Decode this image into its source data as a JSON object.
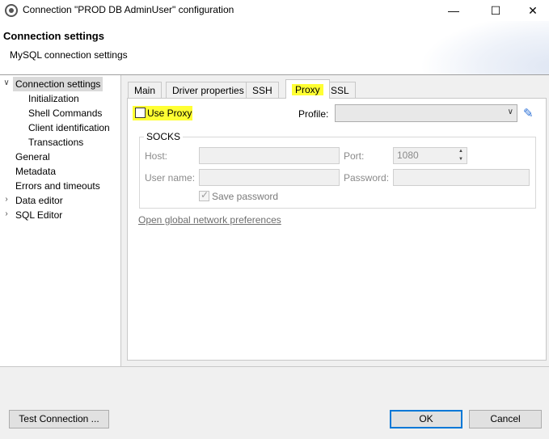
{
  "window": {
    "title": "Connection \"PROD DB AdminUser\" configuration",
    "minimize": "—",
    "maximize": "☐",
    "close": "✕"
  },
  "header": {
    "title": "Connection settings",
    "subtitle": "MySQL connection settings"
  },
  "tree": {
    "items": [
      {
        "label": "Connection settings",
        "expanded": true,
        "selected": true
      },
      {
        "label": "Initialization"
      },
      {
        "label": "Shell Commands"
      },
      {
        "label": "Client identification"
      },
      {
        "label": "Transactions"
      },
      {
        "label": "General"
      },
      {
        "label": "Metadata"
      },
      {
        "label": "Errors and timeouts"
      },
      {
        "label": "Data editor",
        "expandable": true
      },
      {
        "label": "SQL Editor",
        "expandable": true
      }
    ]
  },
  "tabs": [
    {
      "label": "Main"
    },
    {
      "label": "Driver properties"
    },
    {
      "label": "SSH"
    },
    {
      "label": "Proxy",
      "active": true
    },
    {
      "label": "SSL"
    }
  ],
  "proxy": {
    "use_proxy_label": "Use Proxy",
    "use_proxy_checked": false,
    "profile_label": "Profile:",
    "profile_value": "",
    "socks_legend": "SOCKS",
    "host_label": "Host:",
    "host_value": "",
    "port_label": "Port:",
    "port_value": "1080",
    "username_label": "User name:",
    "username_value": "",
    "password_label": "Password:",
    "password_value": "",
    "save_password_label": "Save password",
    "save_password_checked": true,
    "global_link": "Open global network preferences"
  },
  "buttons": {
    "test": "Test Connection ...",
    "ok": "OK",
    "cancel": "Cancel"
  },
  "colors": {
    "highlight": "#ffff33",
    "default_button_border": "#0078d7",
    "edit_icon": "#2a6fd6"
  }
}
